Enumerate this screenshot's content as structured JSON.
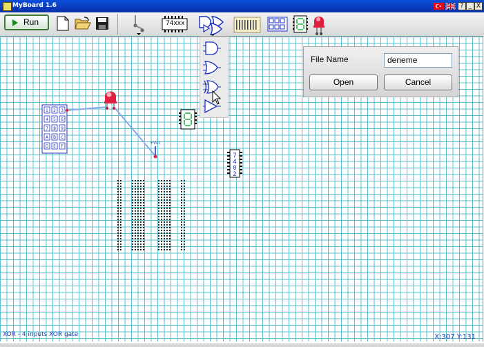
{
  "window": {
    "title": "MyBoard 1.6",
    "min_glyph": "_",
    "max_glyph": "□",
    "close_glyph": "X",
    "help_glyph": "?"
  },
  "toolbar": {
    "run_label": "Run",
    "ic_label": "74xxx"
  },
  "file_dialog": {
    "label": "File Name",
    "value": "deneme",
    "open_label": "Open",
    "cancel_label": "Cancel"
  },
  "canvas": {
    "chip_label": "7402",
    "probe_label": "+Vcc",
    "keypad_keys": [
      "1",
      "2",
      "3",
      "4",
      "5",
      "6",
      "7",
      "8",
      "9",
      "A",
      "B",
      "C",
      "D",
      "E",
      "F"
    ]
  },
  "status": {
    "hint": "XOR - 4 inputs XOR gate",
    "coords": "X:307 Y:131"
  },
  "colors": {
    "grid": "#58c0c8",
    "component_blue": "#1a2fbf",
    "wire": "#8aa8e8",
    "led_red": "#e02040",
    "title_bar": "#0a4fd9"
  }
}
